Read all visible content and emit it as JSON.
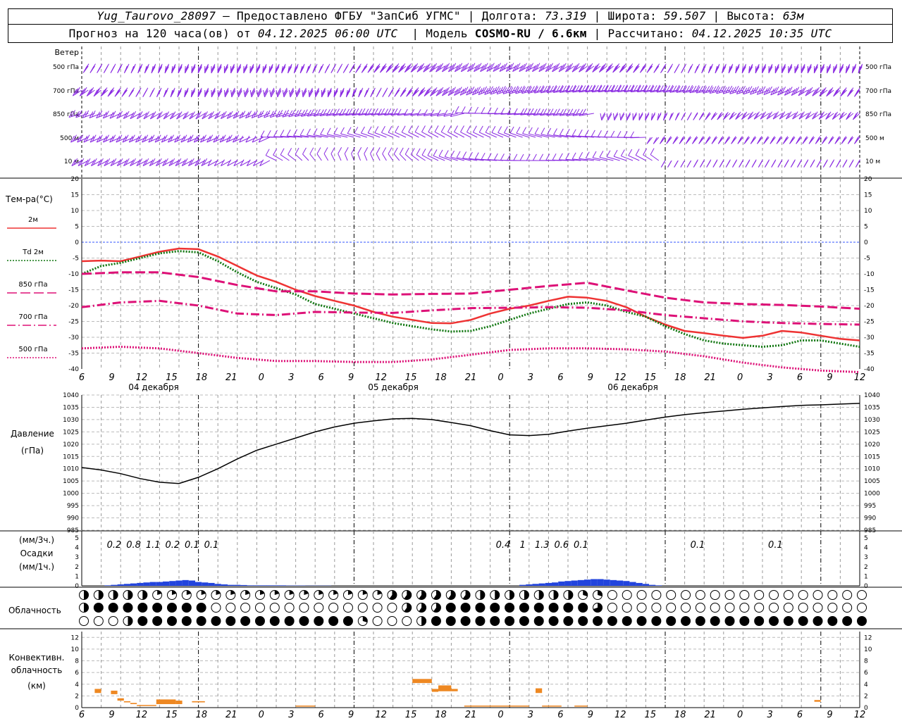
{
  "header": {
    "station": "Yug_Taurovo_28097",
    "provider": "– Предоставлено ФГБУ \"ЗапСиб УГМС\"",
    "lon_label": "Долгота:",
    "lon": "73.319",
    "lat_label": "Широта:",
    "lat": "59.507",
    "alt_label": "Высота:",
    "alt": "63м",
    "forecast_label": "Прогноз на 120 часа(ов) от",
    "forecast_time": "04.12.2025 06:00 UTC",
    "model_label": "Модель",
    "model": "COSMO-RU / 6.6км",
    "calc_label": "Рассчитано:",
    "calc_time": "04.12.2025 10:35 UTC"
  },
  "wind_panel": {
    "title": "Ветер",
    "levels": [
      "500 гПа",
      "700 гПа",
      "850 гПа",
      "500 м",
      "10  м"
    ],
    "barb_color": "#8a2be2"
  },
  "temp_panel": {
    "title": "Тем-ра(°С)",
    "legend": [
      {
        "label": "2м",
        "color": "#ee3333",
        "style": "solid"
      },
      {
        "label": "Td  2м",
        "color": "#117711",
        "style": "dotted"
      },
      {
        "label": "850 гПа",
        "color": "#dd1177",
        "style": "longdash"
      },
      {
        "label": "700 гПа",
        "color": "#dd1177",
        "style": "dashdot"
      },
      {
        "label": "500 гПа",
        "color": "#dd1177",
        "style": "dotted"
      }
    ],
    "ticks": [
      "20",
      "15",
      "10",
      "5",
      "0",
      "-5",
      "-10",
      "-15",
      "-20",
      "-25",
      "-30",
      "-35",
      "-40"
    ]
  },
  "time_axis": {
    "hours": [
      "6",
      "9",
      "12",
      "15",
      "18",
      "21",
      "0",
      "3",
      "6",
      "9",
      "12",
      "15",
      "18",
      "21",
      "0",
      "3",
      "6",
      "9",
      "12",
      "15",
      "18",
      "21",
      "0",
      "3",
      "6",
      "9",
      "12"
    ],
    "days": [
      "04 декабря",
      "05 декабря",
      "06 декабря"
    ]
  },
  "pressure_panel": {
    "title": "Давление",
    "unit": "(гПа)",
    "ticks": [
      "1040",
      "1035",
      "1030",
      "1025",
      "1020",
      "1015",
      "1010",
      "1005",
      "1000",
      "995",
      "990",
      "985"
    ]
  },
  "precip_panel": {
    "unit_top": "(мм/3ч.)",
    "title": "Осадки",
    "unit_bottom": "(мм/1ч.)",
    "ticks": [
      "5",
      "4",
      "3",
      "2",
      "1",
      "0"
    ],
    "bar_color": "#2244dd"
  },
  "cloud_panel": {
    "title": "Облачность"
  },
  "convective_panel": {
    "title_1": "Конвективн.",
    "title_2": "облачность",
    "unit": "(км)",
    "ticks": [
      "12",
      "10",
      "8",
      "6",
      "4",
      "2",
      "0"
    ],
    "bar_color": "#ee8822"
  },
  "chart_data": [
    {
      "type": "line",
      "title": "Тем-ра(°С)",
      "x_unit": "hours since 04.12.2025 06:00 UTC",
      "ylim": [
        -40,
        20
      ],
      "series": [
        {
          "name": "2м",
          "x": [
            0,
            3,
            6,
            9,
            12,
            15,
            18,
            21,
            24,
            27,
            30,
            33,
            36,
            39,
            42,
            45,
            48,
            51,
            54,
            57,
            60,
            63,
            66,
            69,
            72,
            75,
            78,
            81,
            84,
            87,
            90,
            93,
            96,
            99,
            102,
            105,
            108,
            111,
            114,
            117,
            120
          ],
          "values": [
            -6,
            -5.8,
            -6,
            -4.5,
            -3,
            -2,
            -2.2,
            -4.5,
            -7.5,
            -10.5,
            -12.5,
            -15,
            -17,
            -18.5,
            -20,
            -22,
            -23.5,
            -24.5,
            -25.5,
            -25.6,
            -24.5,
            -22.5,
            -21,
            -20,
            -18.5,
            -17.2,
            -17.5,
            -18.5,
            -20.5,
            -23.5,
            -26,
            -28,
            -28.7,
            -29.5,
            -30.2,
            -29.5,
            -28,
            -28.5,
            -29.5,
            -30.5,
            -31
          ]
        },
        {
          "name": "Td  2м",
          "x": [
            0,
            3,
            6,
            9,
            12,
            15,
            18,
            21,
            24,
            27,
            30,
            33,
            36,
            39,
            42,
            45,
            48,
            51,
            54,
            57,
            60,
            63,
            66,
            69,
            72,
            75,
            78,
            81,
            84,
            87,
            90,
            93,
            96,
            99,
            102,
            105,
            108,
            111,
            114,
            117,
            120
          ],
          "values": [
            -10,
            -7.5,
            -6.5,
            -5,
            -3.5,
            -2.8,
            -3.2,
            -6,
            -9.5,
            -12.5,
            -14.5,
            -16.5,
            -19.5,
            -21,
            -22.5,
            -24,
            -25.5,
            -26.5,
            -27.5,
            -28.2,
            -28,
            -26.5,
            -24.5,
            -22.5,
            -21,
            -19.5,
            -19,
            -20,
            -22,
            -23.5,
            -26.5,
            -29,
            -31,
            -32,
            -32.5,
            -33,
            -32.5,
            -31,
            -31,
            -32,
            -33
          ]
        },
        {
          "name": "850 гПа",
          "x": [
            0,
            6,
            12,
            18,
            24,
            30,
            36,
            42,
            48,
            54,
            60,
            66,
            72,
            78,
            84,
            90,
            96,
            102,
            108,
            114,
            120
          ],
          "values": [
            -10,
            -9.5,
            -9.5,
            -11,
            -13.5,
            -15.5,
            -15.5,
            -16.2,
            -16.5,
            -16.3,
            -16.2,
            -15,
            -13.8,
            -12.8,
            -15.2,
            -17.5,
            -19,
            -19.5,
            -19.8,
            -20.3,
            -21
          ]
        },
        {
          "name": "700 гПа",
          "x": [
            0,
            6,
            12,
            18,
            24,
            30,
            36,
            42,
            48,
            54,
            60,
            66,
            72,
            78,
            84,
            90,
            96,
            102,
            108,
            114,
            120
          ],
          "values": [
            -20.5,
            -19,
            -18.5,
            -20,
            -22.5,
            -23,
            -22,
            -22.2,
            -22.3,
            -21.5,
            -20.8,
            -20.7,
            -20.5,
            -20.7,
            -21.5,
            -23,
            -24,
            -25,
            -25.5,
            -25.8,
            -26
          ]
        },
        {
          "name": "500 гПа",
          "x": [
            0,
            6,
            12,
            18,
            24,
            30,
            36,
            42,
            48,
            54,
            60,
            66,
            72,
            78,
            84,
            90,
            96,
            102,
            108,
            114,
            120
          ],
          "values": [
            -33.5,
            -33,
            -33.5,
            -35,
            -36.5,
            -37.5,
            -37.5,
            -37.8,
            -37.8,
            -37,
            -35.5,
            -34,
            -33.5,
            -33.5,
            -33.8,
            -34.5,
            -36,
            -38,
            -39.5,
            -40.5,
            -41
          ]
        }
      ]
    },
    {
      "type": "line",
      "title": "Давление",
      "x_unit": "hours since 04.12.2025 06:00 UTC",
      "ylim": [
        985,
        1040
      ],
      "series": [
        {
          "x": [
            0,
            3,
            6,
            9,
            12,
            15,
            18,
            21,
            24,
            27,
            30,
            33,
            36,
            39,
            42,
            45,
            48,
            51,
            54,
            57,
            60,
            63,
            66,
            69,
            72,
            75,
            78,
            81,
            84,
            87,
            90,
            93,
            96,
            99,
            102,
            105,
            108,
            111,
            114,
            117,
            120
          ],
          "values": [
            1010.5,
            1009.5,
            1008,
            1006,
            1004.5,
            1004,
            1006.5,
            1010,
            1014,
            1017.5,
            1020,
            1022.5,
            1025,
            1027,
            1028.5,
            1029.5,
            1030.3,
            1030.5,
            1030,
            1028.8,
            1027.5,
            1025.5,
            1023.8,
            1023.5,
            1024,
            1025.3,
            1026.5,
            1027.5,
            1028.5,
            1029.8,
            1031,
            1032,
            1032.8,
            1033.5,
            1034.2,
            1034.8,
            1035.3,
            1035.8,
            1036,
            1036.3,
            1036.6
          ]
        }
      ]
    },
    {
      "type": "bar",
      "title": "Осадки",
      "x_unit": "hours since 04.12.2025 06:00 UTC",
      "ylim": [
        0,
        5
      ],
      "hourly_x": [
        4,
        5,
        6,
        7,
        8,
        9,
        10,
        11,
        12,
        13,
        14,
        15,
        16,
        17,
        18,
        19,
        20,
        21,
        22,
        23,
        24,
        25,
        26,
        27,
        28,
        29,
        30,
        31,
        32,
        33,
        34,
        35,
        36,
        37,
        38,
        39,
        40,
        41,
        42,
        43,
        44,
        45,
        46,
        47,
        48,
        49,
        50,
        51,
        52,
        53,
        54,
        55,
        56,
        57,
        58,
        59,
        60,
        61,
        62,
        63,
        64,
        65,
        66,
        67,
        68,
        69,
        70,
        71,
        72,
        73,
        74,
        75,
        76,
        77,
        78,
        79,
        80,
        81,
        82,
        83,
        84,
        85,
        86,
        87,
        88,
        89,
        90,
        91,
        92,
        93,
        94,
        95,
        96,
        97,
        98,
        99,
        100,
        101,
        102,
        103,
        104,
        105,
        106,
        107,
        108,
        109,
        110,
        111,
        112,
        113,
        114,
        115,
        116,
        117,
        118,
        119,
        120
      ],
      "hourly_values": [
        0.05,
        0.1,
        0.15,
        0.2,
        0.25,
        0.3,
        0.35,
        0.4,
        0.4,
        0.45,
        0.5,
        0.55,
        0.6,
        0.55,
        0.4,
        0.35,
        0.3,
        0.2,
        0.15,
        0.1,
        0.1,
        0.08,
        0.05,
        0.05,
        0.05,
        0.05,
        0.05,
        0.05,
        0.03,
        0.03,
        0.03,
        0.02,
        0.02,
        0.02,
        0.02,
        0,
        0,
        0,
        0,
        0,
        0,
        0,
        0,
        0,
        0,
        0,
        0,
        0,
        0,
        0,
        0,
        0,
        0,
        0,
        0,
        0,
        0,
        0,
        0,
        0,
        0,
        0,
        0,
        0,
        0.1,
        0.15,
        0.2,
        0.25,
        0.3,
        0.35,
        0.45,
        0.5,
        0.55,
        0.6,
        0.65,
        0.7,
        0.7,
        0.65,
        0.6,
        0.55,
        0.5,
        0.4,
        0.3,
        0.2,
        0.1,
        0.05,
        0,
        0,
        0,
        0,
        0,
        0,
        0,
        0,
        0,
        0,
        0,
        0,
        0,
        0,
        0,
        0,
        0,
        0,
        0,
        0,
        0,
        0,
        0,
        0,
        0,
        0,
        0,
        0,
        0,
        0,
        0,
        0,
        0,
        0
      ],
      "three_hour_x": [
        5,
        8,
        11,
        14,
        17,
        20,
        23,
        65,
        68,
        71,
        74,
        77,
        80,
        95,
        107
      ],
      "three_hour_labels": [
        "0.2",
        "0.8",
        "1.1",
        "0.2",
        "0.1",
        "0.1",
        "",
        "0.4",
        "1",
        "1.3",
        "0.6",
        "0.1",
        "",
        "0.1",
        "0.1"
      ]
    },
    {
      "type": "bar",
      "title": "Конвективн. облачность",
      "x_unit": "hours since 04.12.2025 06:00 UTC",
      "ylim": [
        0,
        13
      ],
      "bars": [
        {
          "x0": 2,
          "x1": 3,
          "bottom": 2.5,
          "top": 3.2
        },
        {
          "x0": 4.5,
          "x1": 5.5,
          "bottom": 2.3,
          "top": 2.9
        },
        {
          "x0": 5.5,
          "x1": 6.5,
          "bottom": 1.2,
          "top": 1.6
        },
        {
          "x0": 6.5,
          "x1": 7.5,
          "bottom": 0.9,
          "top": 1.1
        },
        {
          "x0": 7.5,
          "x1": 8.5,
          "bottom": 0.6,
          "top": 0.8
        },
        {
          "x0": 8.5,
          "x1": 11.5,
          "bottom": 0.3,
          "top": 0.45
        },
        {
          "x0": 11.5,
          "x1": 14.5,
          "bottom": 0.6,
          "top": 1.4
        },
        {
          "x0": 14.5,
          "x1": 15.5,
          "bottom": 0.6,
          "top": 1.2
        },
        {
          "x0": 17,
          "x1": 19,
          "bottom": 0.9,
          "top": 1.1
        },
        {
          "x0": 33,
          "x1": 36,
          "bottom": 0.2,
          "top": 0.35
        },
        {
          "x0": 51,
          "x1": 54,
          "bottom": 4.2,
          "top": 4.9
        },
        {
          "x0": 54,
          "x1": 55,
          "bottom": 2.7,
          "top": 3.2
        },
        {
          "x0": 55,
          "x1": 57,
          "bottom": 2.8,
          "top": 3.8
        },
        {
          "x0": 57,
          "x1": 58,
          "bottom": 2.8,
          "top": 3.2
        },
        {
          "x0": 59,
          "x1": 69,
          "bottom": 0.2,
          "top": 0.35
        },
        {
          "x0": 70,
          "x1": 71,
          "bottom": 2.5,
          "top": 3.3
        },
        {
          "x0": 71,
          "x1": 74,
          "bottom": 0.2,
          "top": 0.35
        },
        {
          "x0": 76,
          "x1": 78,
          "bottom": 0.2,
          "top": 0.35
        },
        {
          "x0": 113,
          "x1": 114,
          "bottom": 1.0,
          "top": 1.3
        }
      ]
    }
  ]
}
